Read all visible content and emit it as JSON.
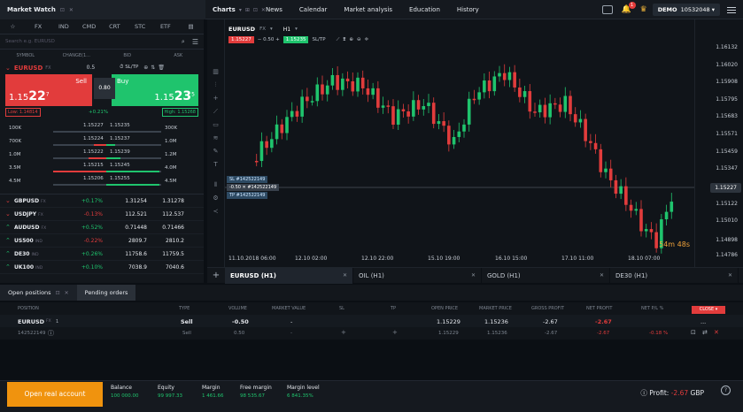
{
  "topbar": {
    "market_watch_title": "Market Watch",
    "charts_title": "Charts",
    "nav": [
      "News",
      "Calendar",
      "Market analysis",
      "Education",
      "History"
    ],
    "notification_count": "1",
    "account_label": "DEMO",
    "account_number": "10532048"
  },
  "market_watch": {
    "categories": [
      "☆",
      "FX",
      "IND",
      "CMD",
      "CRT",
      "STC",
      "ETF"
    ],
    "search_placeholder": "Search e.g. EURUSD",
    "columns": [
      "SYMBOL",
      "CHANGE(1...",
      "BID",
      "ASK"
    ],
    "selected": {
      "symbol": "EURUSD",
      "market": "FX",
      "volume": "0.5",
      "sltp_label": "SL/TP",
      "sell_label": "Sell",
      "buy_label": "Buy",
      "sell_price_main": "1.15",
      "sell_price_big": "22",
      "sell_price_frac": "7",
      "buy_price_main": "1.15",
      "buy_price_big": "23",
      "buy_price_frac": "5",
      "spread": "0.80",
      "low": "Low: 1.14814",
      "change": "+0.21%",
      "high": "High: 1.15268"
    },
    "depth": [
      {
        "vol_left": "100K",
        "bid": "1.15227",
        "ask": "1.15235",
        "vol_right": "300K",
        "bid_bar": 0,
        "ask_bar": 0
      },
      {
        "vol_left": "700K",
        "bid": "1.15224",
        "ask": "1.15237",
        "vol_right": "1.0M",
        "bid_bar": 14,
        "ask_bar": 10
      },
      {
        "vol_left": "1.0M",
        "bid": "1.15222",
        "ask": "1.15239",
        "vol_right": "1.2M",
        "bid_bar": 20,
        "ask_bar": 16
      },
      {
        "vol_left": "3.5M",
        "bid": "1.15215",
        "ask": "1.15245",
        "vol_right": "4.0M",
        "bid_bar": 60,
        "ask_bar": 60
      },
      {
        "vol_left": "4.5M",
        "bid": "1.15206",
        "ask": "1.15255",
        "vol_right": "4.5M",
        "bid_bar": 0,
        "ask_bar": 60
      }
    ],
    "quotes": [
      {
        "dir": "down",
        "symbol": "GBPUSD",
        "market": "FX",
        "change": "+0.17%",
        "change_dir": "up",
        "bid": "1.31254",
        "ask": "1.31278"
      },
      {
        "dir": "down",
        "symbol": "USDJPY",
        "market": "FX",
        "change": "-0.13%",
        "change_dir": "down",
        "bid": "112.521",
        "ask": "112.537"
      },
      {
        "dir": "up",
        "symbol": "AUDUSD",
        "market": "FX",
        "change": "+0.52%",
        "change_dir": "up",
        "bid": "0.71448",
        "ask": "0.71466"
      },
      {
        "dir": "up",
        "symbol": "US500",
        "market": "IND",
        "change": "-0.22%",
        "change_dir": "down",
        "bid": "2809.7",
        "ask": "2810.2"
      },
      {
        "dir": "up",
        "symbol": "DE30",
        "market": "IND",
        "change": "+0.26%",
        "change_dir": "up",
        "bid": "11758.6",
        "ask": "11759.5"
      },
      {
        "dir": "up",
        "symbol": "UK100",
        "market": "IND",
        "change": "+0.10%",
        "change_dir": "up",
        "bid": "7038.9",
        "ask": "7040.6"
      }
    ]
  },
  "chart": {
    "symbol": "EURUSD",
    "market": "FX",
    "timeframe": "H1",
    "sell_price": "1.15227",
    "volume": "0.50",
    "buy_price": "1.15235",
    "sltp": "SL/TP",
    "y_ticks": [
      "1.16132",
      "1.16020",
      "1.15908",
      "1.15795",
      "1.15683",
      "1.15571",
      "1.15459",
      "1.15347",
      "1.15122",
      "1.15010",
      "1.14898",
      "1.14786"
    ],
    "current_price": "1.15227",
    "timer": "54m 48s",
    "x_labels": [
      "11.10.2018 06:00",
      "12.10 02:00",
      "12.10 22:00",
      "15.10 19:00",
      "16.10 15:00",
      "17.10 11:00",
      "18.10 07:00"
    ],
    "order_labels": {
      "sl": "SL  #142522149",
      "entry_vol": "-0.50",
      "entry": "#142522149",
      "tp": "TP  #142522149"
    },
    "tabs": [
      "EURUSD (H1)",
      "OIL (H1)",
      "GOLD (H1)",
      "DE30 (H1)"
    ],
    "accent_up": "#1fc46d",
    "accent_down": "#e23c3c"
  },
  "positions": {
    "tabs": [
      "Open positions",
      "Pending orders"
    ],
    "columns": [
      "POSITION",
      "TYPE",
      "VOLUME",
      "MARKET VALUE",
      "SL",
      "TP",
      "OPEN PRICE",
      "MARKET PRICE",
      "GROSS PROFIT",
      "NET PROFIT",
      "NET P/L %"
    ],
    "close_label": "CLOSE",
    "row": {
      "symbol": "EURUSD",
      "market": "FX",
      "count": "1",
      "type": "Sell",
      "volume": "-0.50",
      "market_value": "-",
      "sl": "",
      "tp": "",
      "open_price": "1.15229",
      "market_price": "1.15236",
      "gross": "-2.67",
      "net": "-2.67",
      "more": "..."
    },
    "sub": {
      "id": "142522149",
      "type": "Sell",
      "volume": "0.50",
      "market_value": "-",
      "sl": "+",
      "tp": "+",
      "open_price": "1.15229",
      "market_price": "1.15236",
      "gross": "-2.67",
      "net": "-2.67",
      "pl": "-0.18 %"
    }
  },
  "footer": {
    "real_account": "Open real account",
    "stats": [
      {
        "label": "Balance",
        "value": "100 000.00"
      },
      {
        "label": "Equity",
        "value": "99 997.33"
      },
      {
        "label": "Margin",
        "value": "1 461.66"
      },
      {
        "label": "Free margin",
        "value": "98 535.67"
      },
      {
        "label": "Margin level",
        "value": "6 841.35%"
      }
    ],
    "profit_label": "Profit:",
    "profit_value": "-2.67",
    "currency": "GBP"
  }
}
